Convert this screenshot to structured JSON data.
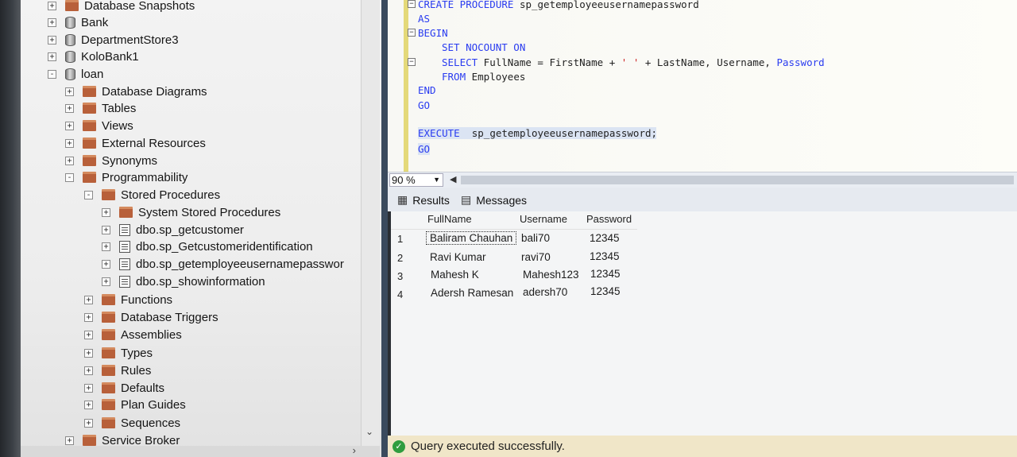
{
  "object_explorer": {
    "items": [
      {
        "label": "Database Snapshots",
        "expander": "+",
        "icon": "folder-icon"
      },
      {
        "label": "Bank",
        "expander": "+",
        "icon": "database-icon"
      },
      {
        "label": "DepartmentStore3",
        "expander": "+",
        "icon": "database-icon"
      },
      {
        "label": "KoloBank1",
        "expander": "+",
        "icon": "database-icon"
      },
      {
        "label": "loan",
        "expander": "-",
        "icon": "database-icon"
      },
      {
        "label": "Database Diagrams",
        "expander": "+",
        "icon": "folder-icon"
      },
      {
        "label": "Tables",
        "expander": "+",
        "icon": "folder-icon"
      },
      {
        "label": "Views",
        "expander": "+",
        "icon": "folder-icon"
      },
      {
        "label": "External Resources",
        "expander": "+",
        "icon": "folder-icon"
      },
      {
        "label": "Synonyms",
        "expander": "+",
        "icon": "folder-icon"
      },
      {
        "label": "Programmability",
        "expander": "-",
        "icon": "folder-icon"
      },
      {
        "label": "Stored Procedures",
        "expander": "-",
        "icon": "folder-icon"
      },
      {
        "label": "System Stored Procedures",
        "expander": "+",
        "icon": "folder-icon"
      },
      {
        "label": "dbo.sp_getcustomer",
        "expander": "+",
        "icon": "stored-procedure-icon"
      },
      {
        "label": "dbo.sp_Getcustomeridentification",
        "expander": "+",
        "icon": "stored-procedure-icon"
      },
      {
        "label": "dbo.sp_getemployeeusernamepasswor",
        "expander": "+",
        "icon": "stored-procedure-icon"
      },
      {
        "label": "dbo.sp_showinformation",
        "expander": "+",
        "icon": "stored-procedure-icon"
      },
      {
        "label": "Functions",
        "expander": "+",
        "icon": "folder-icon"
      },
      {
        "label": "Database Triggers",
        "expander": "+",
        "icon": "folder-icon"
      },
      {
        "label": "Assemblies",
        "expander": "+",
        "icon": "folder-icon"
      },
      {
        "label": "Types",
        "expander": "+",
        "icon": "folder-icon"
      },
      {
        "label": "Rules",
        "expander": "+",
        "icon": "folder-icon"
      },
      {
        "label": "Defaults",
        "expander": "+",
        "icon": "folder-icon"
      },
      {
        "label": "Plan Guides",
        "expander": "+",
        "icon": "folder-icon"
      },
      {
        "label": "Sequences",
        "expander": "+",
        "icon": "folder-icon"
      },
      {
        "label": "Service Broker",
        "expander": "+",
        "icon": "folder-icon"
      }
    ]
  },
  "editor": {
    "lines": {
      "l1_kw": "CREATE PROCEDURE",
      "l1_name": " sp_getemployeeusernamepassword",
      "l2": "AS",
      "l3": "BEGIN",
      "l4_kw": "SET NOCOUNT ON",
      "l5_kw1": "SELECT",
      "l5_mid": " FullName = FirstName + ",
      "l5_str": "' '",
      "l5_rest": " + LastName, Username, ",
      "l5_kw2": "Password",
      "l6_kw": "FROM",
      "l6_rest": " Employees",
      "l7": "END",
      "l8": "GO",
      "l9_kw": "EXECUTE",
      "l9_rest": "  sp_getemployeeusernamepassword;",
      "l10": "GO"
    }
  },
  "zoom": {
    "value": "90 %"
  },
  "tabs": {
    "results": "Results",
    "messages": "Messages"
  },
  "results": {
    "columns": [
      "FullName",
      "Username",
      "Password"
    ],
    "rows": [
      {
        "n": "1",
        "full": "Baliram Chauhan",
        "user": "bali70",
        "pass": "12345"
      },
      {
        "n": "2",
        "full": "Ravi Kumar",
        "user": "ravi70",
        "pass": "12345"
      },
      {
        "n": "3",
        "full": "Mahesh K",
        "user": "Mahesh123",
        "pass": "12345"
      },
      {
        "n": "4",
        "full": "Adersh Ramesan",
        "user": "adersh70",
        "pass": "12345"
      }
    ]
  },
  "status": {
    "message": "Query executed successfully."
  }
}
